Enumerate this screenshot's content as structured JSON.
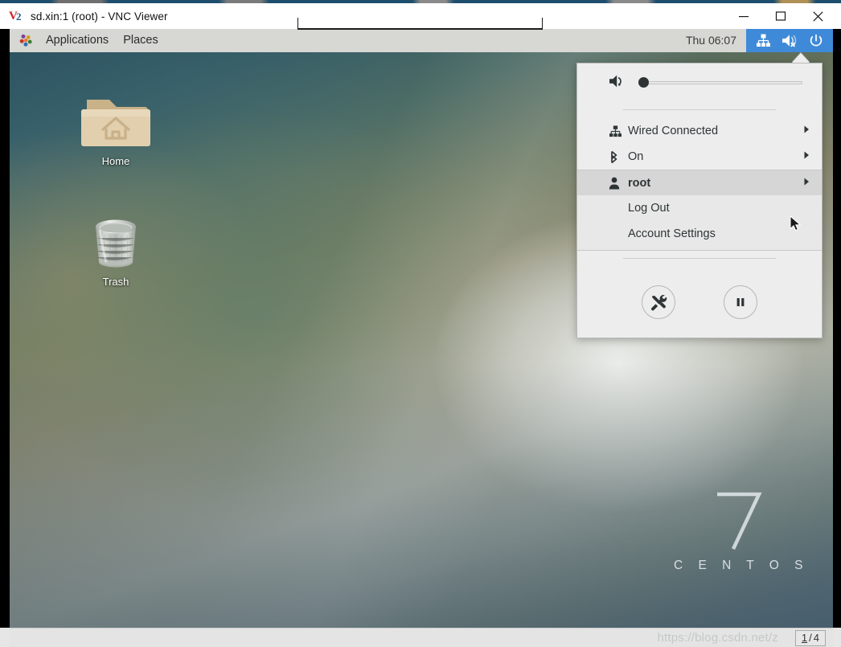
{
  "window": {
    "title": "sd.xin:1 (root) - VNC Viewer",
    "logo_mark": "V2",
    "controls": {
      "minimize": "minimize-button",
      "maximize": "maximize-button",
      "close": "close-button"
    }
  },
  "vnc": {
    "toolbar_handle": "vnc-toolbar-handle"
  },
  "panel": {
    "foot_icon": "gnome-foot-icon",
    "applications": "Applications",
    "places": "Places",
    "clock": "Thu 06:07",
    "status_icons": [
      "network-wired-icon",
      "volume-muted-icon",
      "power-icon"
    ],
    "status_accent": "#3f8ad8"
  },
  "desktop": {
    "icons": [
      {
        "label": "Home",
        "icon": "home-folder-icon"
      },
      {
        "label": "Trash",
        "icon": "trash-icon"
      }
    ],
    "watermark": {
      "number": "7",
      "word": "C E N T O S"
    }
  },
  "menu": {
    "volume": {
      "icon": "volume-low-icon",
      "value": 0
    },
    "rows": [
      {
        "label": "Wired Connected",
        "icon": "network-wired-icon",
        "chevron": "chevron-right-icon"
      },
      {
        "label": "On",
        "icon": "bluetooth-icon",
        "chevron": "chevron-right-icon"
      },
      {
        "label": "root",
        "icon": "user-icon",
        "chevron": "chevron-right-icon"
      }
    ],
    "submenu": [
      {
        "label": "Log Out"
      },
      {
        "label": "Account Settings"
      }
    ],
    "actions": [
      {
        "name": "settings-button",
        "icon": "tools-icon"
      },
      {
        "name": "suspend-button",
        "icon": "pause-icon"
      }
    ]
  },
  "statusbar": {
    "watermark": "https://blog.csdn.net/z",
    "page_current": "1",
    "page_separator": "/",
    "page_total": "4"
  }
}
